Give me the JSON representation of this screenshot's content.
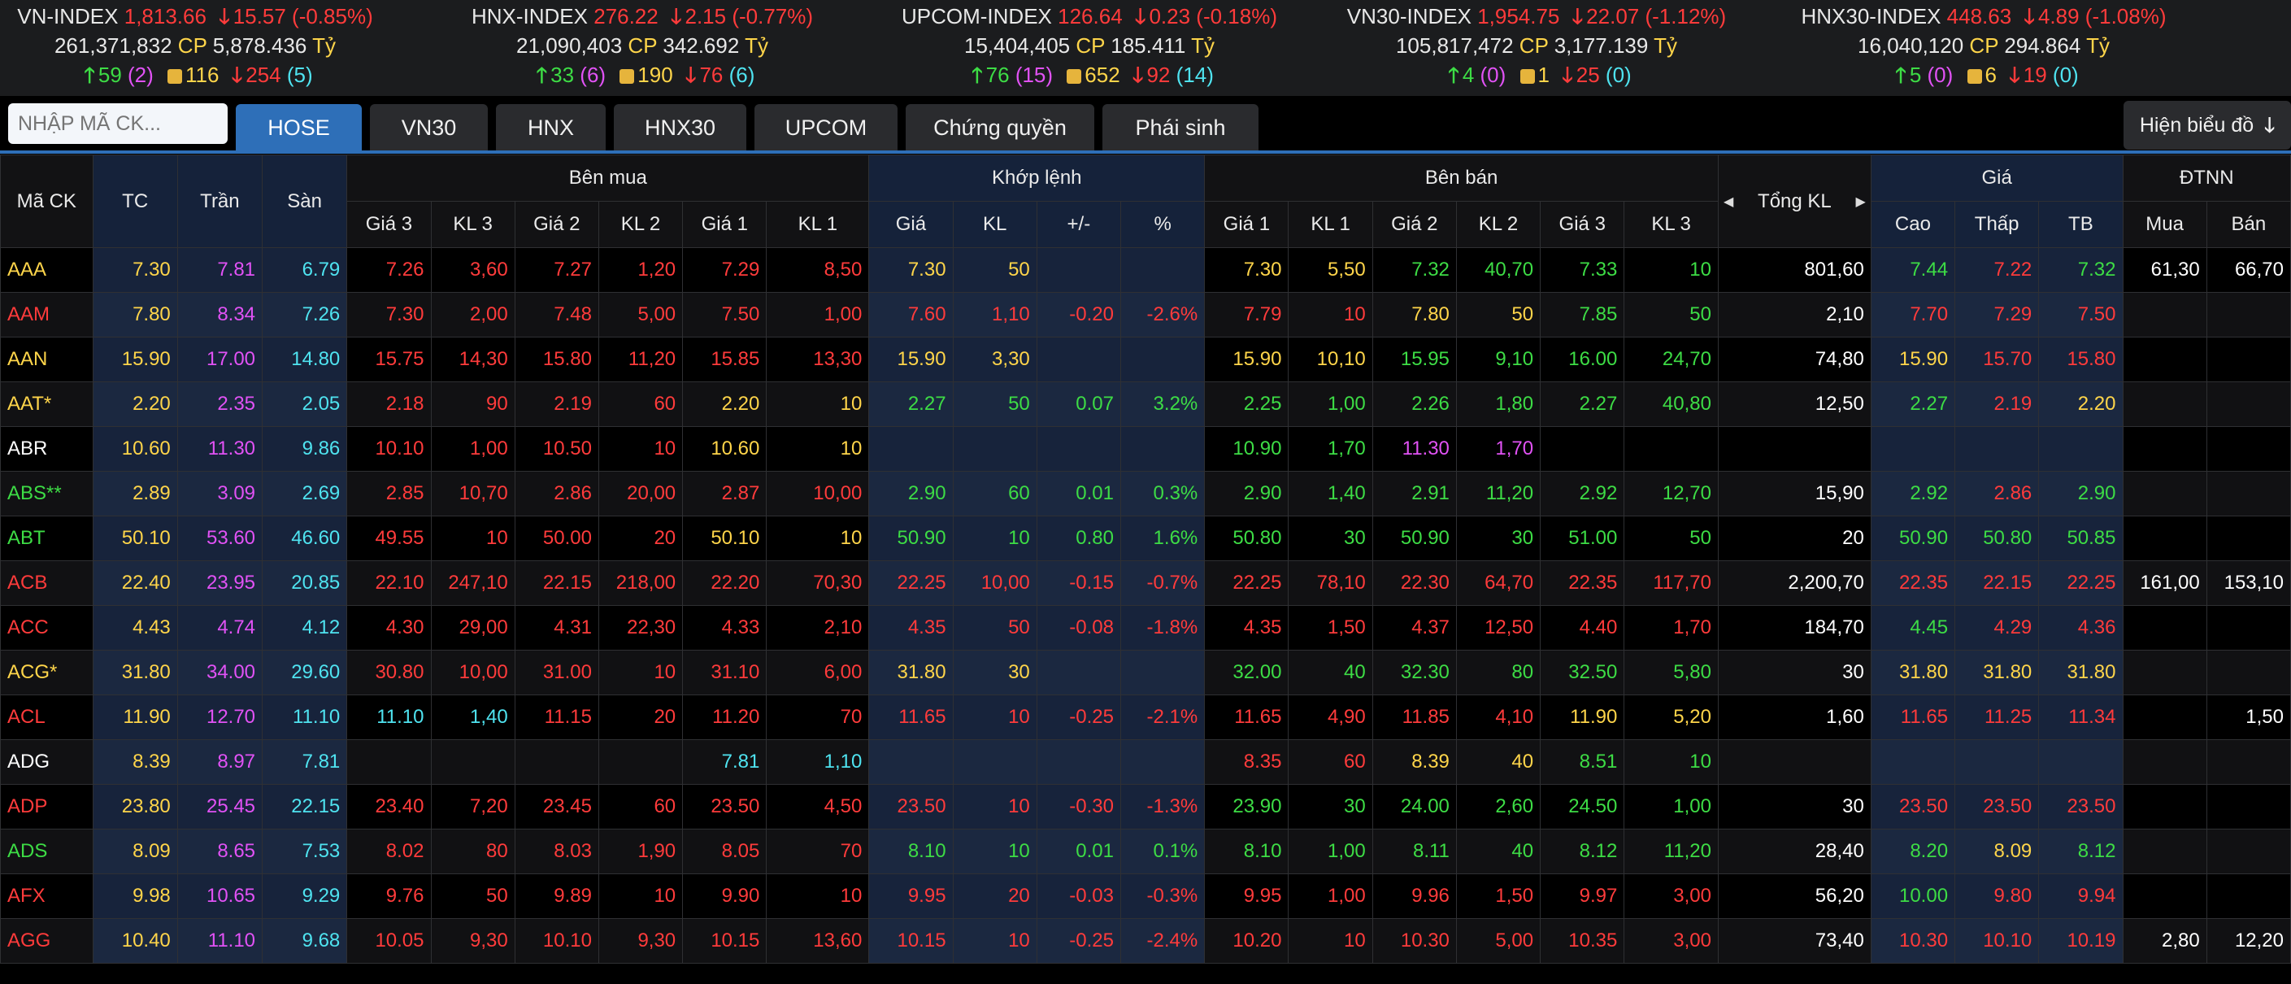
{
  "indices": [
    {
      "name": "VN-INDEX",
      "value": "1,813.66",
      "change": "15.57",
      "pct": "(-0.85%)",
      "dir": "down",
      "volume": "261,371,832",
      "cp_label": "CP",
      "value_ty": "5,878.436",
      "ty_label": "Tỷ",
      "up": "59",
      "ceil": "(2)",
      "ref": "116",
      "down": "254",
      "floor": "(5)"
    },
    {
      "name": "HNX-INDEX",
      "value": "276.22",
      "change": "2.15",
      "pct": "(-0.77%)",
      "dir": "down",
      "volume": "21,090,403",
      "cp_label": "CP",
      "value_ty": "342.692",
      "ty_label": "Tỷ",
      "up": "33",
      "ceil": "(6)",
      "ref": "190",
      "down": "76",
      "floor": "(6)"
    },
    {
      "name": "UPCOM-INDEX",
      "value": "126.64",
      "change": "0.23",
      "pct": "(-0.18%)",
      "dir": "down",
      "volume": "15,404,405",
      "cp_label": "CP",
      "value_ty": "185.411",
      "ty_label": "Tỷ",
      "up": "76",
      "ceil": "(15)",
      "ref": "652",
      "down": "92",
      "floor": "(14)"
    },
    {
      "name": "VN30-INDEX",
      "value": "1,954.75",
      "change": "22.07",
      "pct": "(-1.12%)",
      "dir": "down",
      "volume": "105,817,472",
      "cp_label": "CP",
      "value_ty": "3,177.139",
      "ty_label": "Tỷ",
      "up": "4",
      "ceil": "(0)",
      "ref": "1",
      "down": "25",
      "floor": "(0)"
    },
    {
      "name": "HNX30-INDEX",
      "value": "448.63",
      "change": "4.89",
      "pct": "(-1.08%)",
      "dir": "down",
      "volume": "16,040,120",
      "cp_label": "CP",
      "value_ty": "294.864",
      "ty_label": "Tỷ",
      "up": "5",
      "ceil": "(0)",
      "ref": "6",
      "down": "19",
      "floor": "(0)"
    }
  ],
  "search": {
    "placeholder": "NHẬP MÃ CK..."
  },
  "tabs": [
    {
      "label": "HOSE",
      "active": true
    },
    {
      "label": "VN30"
    },
    {
      "label": "HNX"
    },
    {
      "label": "HNX30"
    },
    {
      "label": "UPCOM"
    },
    {
      "label": "Chứng quyền"
    },
    {
      "label": "Phái sinh"
    }
  ],
  "chart_button": {
    "label": "Hiện biểu đồ"
  },
  "table": {
    "group_headers": {
      "symbol": "Mã CK",
      "ref": "TC",
      "ceil": "Trần",
      "floor": "Sàn",
      "buy": "Bên mua",
      "match": "Khớp lệnh",
      "sell": "Bên bán",
      "total": "Tổng KL",
      "price": "Giá",
      "foreign": "ĐTNN"
    },
    "sub_headers": {
      "buy": [
        "Giá 3",
        "KL 3",
        "Giá 2",
        "KL 2",
        "Giá 1",
        "KL 1"
      ],
      "match": [
        "Giá",
        "KL",
        "+/-",
        "%"
      ],
      "sell": [
        "Giá 1",
        "KL 1",
        "Giá 2",
        "KL 2",
        "Giá 3",
        "KL 3"
      ],
      "price": [
        "Cao",
        "Thấp",
        "TB"
      ],
      "foreign": [
        "Mua",
        "Bán"
      ]
    },
    "colors": {
      "Y": "#ffd54a",
      "R": "#ff3b3b",
      "G": "#3ddc45",
      "P": "#e152f5",
      "C": "#4fe3f0",
      "W": "#ffffff"
    },
    "rows": [
      {
        "c": [
          "AAA",
          "7.30",
          "7.81",
          "6.79",
          "7.26",
          "3,60",
          "7.27",
          "1,20",
          "7.29",
          "8,50",
          "7.30",
          "50",
          "",
          "",
          "7.30",
          "5,50",
          "7.32",
          "40,70",
          "7.33",
          "10",
          "801,60",
          "7.44",
          "7.22",
          "7.32",
          "61,30",
          "66,70"
        ],
        "k": "YYPCRRRRRRYY__YYGGGGWGRGWW"
      },
      {
        "c": [
          "AAM",
          "7.80",
          "8.34",
          "7.26",
          "7.30",
          "2,00",
          "7.48",
          "5,00",
          "7.50",
          "1,00",
          "7.60",
          "1,10",
          "-0.20",
          "-2.6%",
          "7.79",
          "10",
          "7.80",
          "50",
          "7.85",
          "50",
          "2,10",
          "7.70",
          "7.29",
          "7.50",
          "",
          ""
        ],
        "k": "RYPCRRRRRRRRRRRRYYGGWRRRWW"
      },
      {
        "c": [
          "AAN",
          "15.90",
          "17.00",
          "14.80",
          "15.75",
          "14,30",
          "15.80",
          "11,20",
          "15.85",
          "13,30",
          "15.90",
          "3,30",
          "",
          "",
          "15.90",
          "10,10",
          "15.95",
          "9,10",
          "16.00",
          "24,70",
          "74,80",
          "15.90",
          "15.70",
          "15.80",
          "",
          ""
        ],
        "k": "YYPCRRRRRRYY__YYGGGGWYRRWW"
      },
      {
        "c": [
          "AAT*",
          "2.20",
          "2.35",
          "2.05",
          "2.18",
          "90",
          "2.19",
          "60",
          "2.20",
          "10",
          "2.27",
          "50",
          "0.07",
          "3.2%",
          "2.25",
          "1,00",
          "2.26",
          "1,80",
          "2.27",
          "40,80",
          "12,50",
          "2.27",
          "2.19",
          "2.20",
          "",
          ""
        ],
        "k": "YYPCRRRRYYGGGGGGGGGGWGRYWW"
      },
      {
        "c": [
          "ABR",
          "10.60",
          "11.30",
          "9.86",
          "10.10",
          "1,00",
          "10.50",
          "10",
          "10.60",
          "10",
          "",
          "",
          "",
          "",
          "10.90",
          "1,70",
          "11.30",
          "1,70",
          "",
          "",
          "",
          "",
          "",
          "",
          "",
          ""
        ],
        "k": "WYPCRRRRYY____GGPP__WWWWWW"
      },
      {
        "c": [
          "ABS**",
          "2.89",
          "3.09",
          "2.69",
          "2.85",
          "10,70",
          "2.86",
          "20,00",
          "2.87",
          "10,00",
          "2.90",
          "60",
          "0.01",
          "0.3%",
          "2.90",
          "1,40",
          "2.91",
          "11,20",
          "2.92",
          "12,70",
          "15,90",
          "2.92",
          "2.86",
          "2.90",
          "",
          ""
        ],
        "k": "GYPCRRRRRRGGGGGGGGGGWGRGWW"
      },
      {
        "c": [
          "ABT",
          "50.10",
          "53.60",
          "46.60",
          "49.55",
          "10",
          "50.00",
          "20",
          "50.10",
          "10",
          "50.90",
          "10",
          "0.80",
          "1.6%",
          "50.80",
          "30",
          "50.90",
          "30",
          "51.00",
          "50",
          "20",
          "50.90",
          "50.80",
          "50.85",
          "",
          ""
        ],
        "k": "GYPCRRRRYYGGGGGGGGGGWGGGWW"
      },
      {
        "c": [
          "ACB",
          "22.40",
          "23.95",
          "20.85",
          "22.10",
          "247,10",
          "22.15",
          "218,00",
          "22.20",
          "70,30",
          "22.25",
          "10,00",
          "-0.15",
          "-0.7%",
          "22.25",
          "78,10",
          "22.30",
          "64,70",
          "22.35",
          "117,70",
          "2,200,70",
          "22.35",
          "22.15",
          "22.25",
          "161,00",
          "153,10"
        ],
        "k": "RYPCRRRRRRRRRRRRRRRRWRRRWW"
      },
      {
        "c": [
          "ACC",
          "4.43",
          "4.74",
          "4.12",
          "4.30",
          "29,00",
          "4.31",
          "22,30",
          "4.33",
          "2,10",
          "4.35",
          "50",
          "-0.08",
          "-1.8%",
          "4.35",
          "1,50",
          "4.37",
          "12,50",
          "4.40",
          "1,70",
          "184,70",
          "4.45",
          "4.29",
          "4.36",
          "",
          ""
        ],
        "k": "RYPCRRRRRRRRRRRRRRRRWGRRWW"
      },
      {
        "c": [
          "ACG*",
          "31.80",
          "34.00",
          "29.60",
          "30.80",
          "10,00",
          "31.00",
          "10",
          "31.10",
          "6,00",
          "31.80",
          "30",
          "",
          "",
          "32.00",
          "40",
          "32.30",
          "80",
          "32.50",
          "5,80",
          "30",
          "31.80",
          "31.80",
          "31.80",
          "",
          ""
        ],
        "k": "YYPCRRRRRRYY__GGGGGGWYYYWW"
      },
      {
        "c": [
          "ACL",
          "11.90",
          "12.70",
          "11.10",
          "11.10",
          "1,40",
          "11.15",
          "20",
          "11.20",
          "70",
          "11.65",
          "10",
          "-0.25",
          "-2.1%",
          "11.65",
          "4,90",
          "11.85",
          "4,10",
          "11.90",
          "5,20",
          "1,60",
          "11.65",
          "11.25",
          "11.34",
          "",
          "1,50"
        ],
        "k": "RYPCCCRRRRRRRRRRRRYYWRRRWW"
      },
      {
        "c": [
          "ADG",
          "8.39",
          "8.97",
          "7.81",
          "",
          "",
          "",
          "",
          "7.81",
          "1,10",
          "",
          "",
          "",
          "",
          "8.35",
          "60",
          "8.39",
          "40",
          "8.51",
          "10",
          "",
          "",
          "",
          "",
          "",
          ""
        ],
        "k": "WYPC____CC____RRYYGGWWWWWW"
      },
      {
        "c": [
          "ADP",
          "23.80",
          "25.45",
          "22.15",
          "23.40",
          "7,20",
          "23.45",
          "60",
          "23.50",
          "4,50",
          "23.50",
          "10",
          "-0.30",
          "-1.3%",
          "23.90",
          "30",
          "24.00",
          "2,60",
          "24.50",
          "1,00",
          "30",
          "23.50",
          "23.50",
          "23.50",
          "",
          ""
        ],
        "k": "RYPCRRRRRRRRRRGGGGGGWRRRWW"
      },
      {
        "c": [
          "ADS",
          "8.09",
          "8.65",
          "7.53",
          "8.02",
          "80",
          "8.03",
          "1,90",
          "8.05",
          "70",
          "8.10",
          "10",
          "0.01",
          "0.1%",
          "8.10",
          "1,00",
          "8.11",
          "40",
          "8.12",
          "11,20",
          "28,40",
          "8.20",
          "8.09",
          "8.12",
          "",
          ""
        ],
        "k": "GYPCRRRRRRGGGGGGGGGGWGYGWW"
      },
      {
        "c": [
          "AFX",
          "9.98",
          "10.65",
          "9.29",
          "9.76",
          "50",
          "9.89",
          "10",
          "9.90",
          "10",
          "9.95",
          "20",
          "-0.03",
          "-0.3%",
          "9.95",
          "1,00",
          "9.96",
          "1,50",
          "9.97",
          "3,00",
          "56,20",
          "10.00",
          "9.80",
          "9.94",
          "",
          ""
        ],
        "k": "RYPCRRRRRRRRRRRRRRRRWGRRWW"
      },
      {
        "c": [
          "AGG",
          "10.40",
          "11.10",
          "9.68",
          "10.05",
          "9,30",
          "10.10",
          "9,30",
          "10.15",
          "13,60",
          "10.15",
          "10",
          "-0.25",
          "-2.4%",
          "10.20",
          "10",
          "10.30",
          "5,00",
          "10.35",
          "3,00",
          "73,40",
          "10.30",
          "10.10",
          "10.19",
          "2,80",
          "12,20"
        ],
        "k": "RYPCRRRRRRRRRRRRRRRRWRRRWW"
      }
    ]
  }
}
